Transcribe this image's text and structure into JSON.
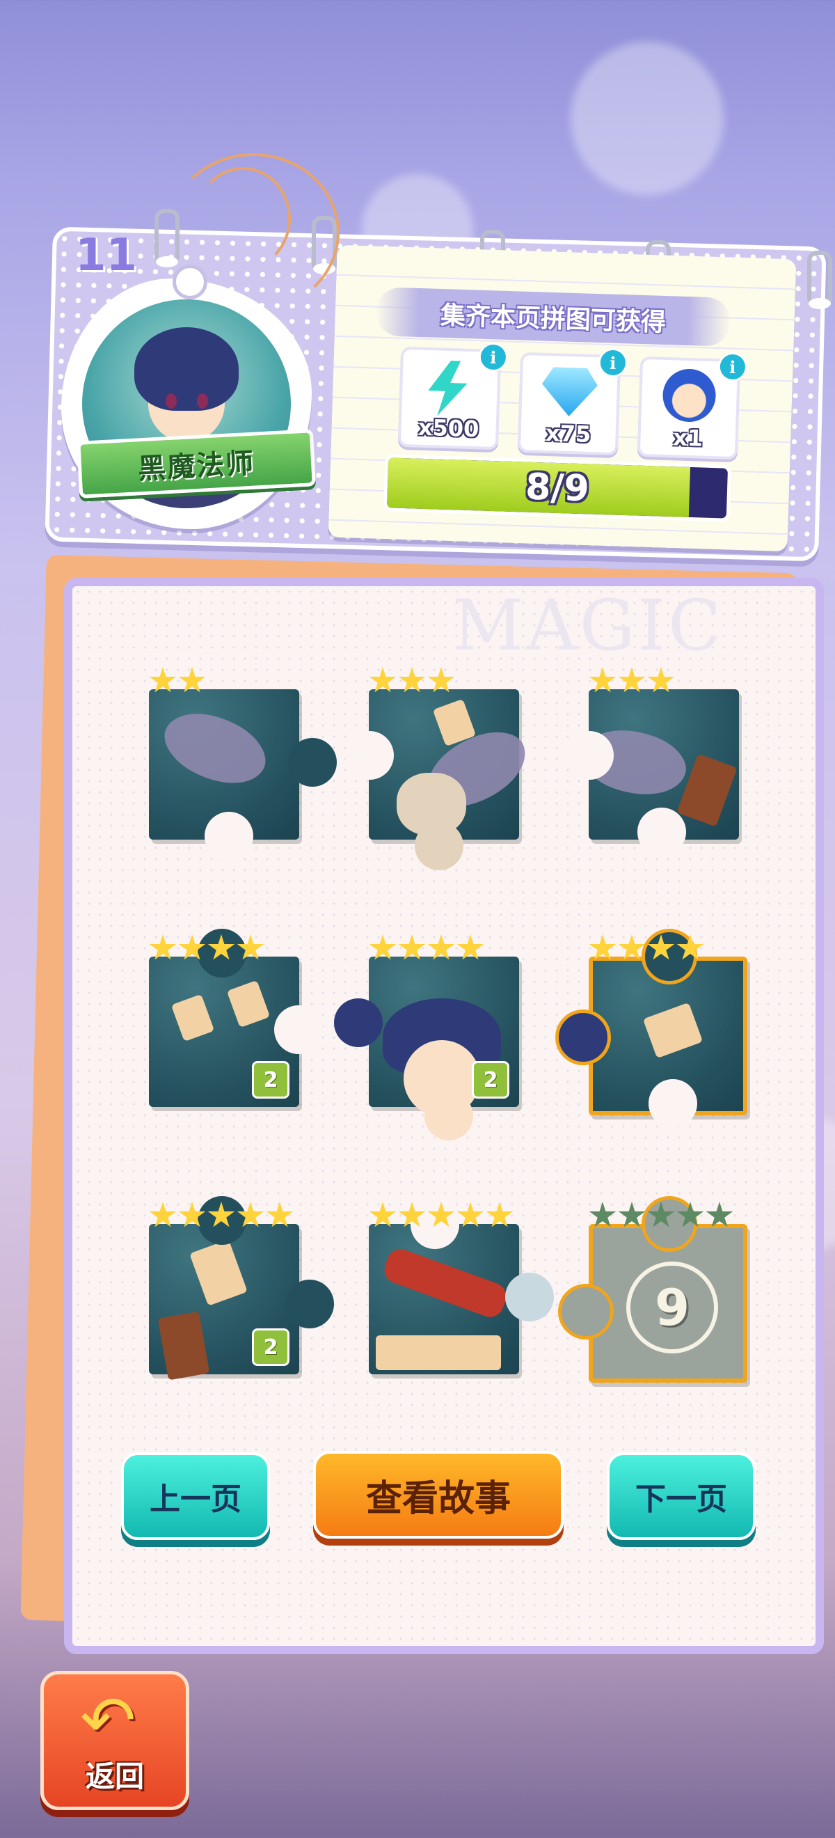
{
  "album": {
    "page_number": "11",
    "character_name": "黑魔法师",
    "watermark": "MAGIC"
  },
  "rewards": {
    "title": "集齐本页拼图可获得",
    "items": [
      {
        "icon": "energy-bolt-icon",
        "count": "x500"
      },
      {
        "icon": "diamond-icon",
        "count": "x75"
      },
      {
        "icon": "jester-box-icon",
        "count": "x1"
      }
    ],
    "info_glyph": "i",
    "progress_text": "8/9",
    "progress_collected": 8,
    "progress_total": 9
  },
  "pieces": [
    {
      "stars": 2,
      "max_stars": 2
    },
    {
      "stars": 3,
      "max_stars": 3
    },
    {
      "stars": 3,
      "max_stars": 3
    },
    {
      "stars": 4,
      "max_stars": 4,
      "duplicate": "2"
    },
    {
      "stars": 4,
      "max_stars": 4,
      "duplicate": "2"
    },
    {
      "stars": 4,
      "max_stars": 4
    },
    {
      "stars": 5,
      "max_stars": 5,
      "duplicate": "2"
    },
    {
      "stars": 5,
      "max_stars": 5
    },
    {
      "stars": 0,
      "max_stars": 5,
      "locked_label": "9"
    }
  ],
  "buttons": {
    "prev": "上一页",
    "story": "查看故事",
    "next": "下一页",
    "back": "返回"
  },
  "colors": {
    "teal_button": "#12b9b0",
    "orange_button": "#f57c13",
    "progress_fill": "#b7dc2d",
    "star": "#ffd33b"
  }
}
